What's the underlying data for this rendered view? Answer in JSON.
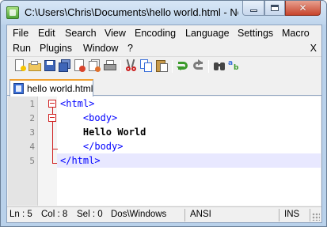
{
  "window": {
    "title": "C:\\Users\\Chris\\Documents\\hello world.html - Notepad++",
    "close_glyph": "✕"
  },
  "menu": {
    "row1": [
      "File",
      "Edit",
      "Search",
      "View",
      "Encoding",
      "Language",
      "Settings",
      "Macro"
    ],
    "row2": [
      "Run",
      "Plugins",
      "Window",
      "?"
    ],
    "close_x": "X"
  },
  "toolbar": {
    "buttons": [
      "new-file-icon",
      "open-file-icon",
      "save-icon",
      "save-all-icon",
      "close-icon",
      "close-all-icon",
      "print-icon",
      "cut-icon",
      "copy-icon",
      "paste-icon",
      "undo-icon",
      "redo-icon",
      "find-icon",
      "replace-icon"
    ]
  },
  "tabs": [
    {
      "label": "hello world.html",
      "active": true
    }
  ],
  "editor": {
    "lines": [
      {
        "num": "1",
        "segments": [
          {
            "cls": "tag",
            "text": "<html>"
          }
        ]
      },
      {
        "num": "2",
        "segments": [
          {
            "cls": "tag",
            "text": "    <body>"
          }
        ]
      },
      {
        "num": "3",
        "segments": [
          {
            "cls": "text",
            "text": "    Hello World"
          }
        ]
      },
      {
        "num": "4",
        "segments": [
          {
            "cls": "tag",
            "text": "    </body>"
          }
        ]
      },
      {
        "num": "5",
        "segments": [
          {
            "cls": "tag",
            "text": "</html>"
          }
        ]
      }
    ],
    "current_line": 5
  },
  "status": {
    "ln": "Ln : 5",
    "col": "Col : 8",
    "sel": "Sel : 0",
    "eol": "Dos\\Windows",
    "encoding": "ANSI",
    "mode": "INS"
  },
  "colors": {
    "tag": "#0000ff",
    "fold_marker": "#d02020",
    "current_line": "#e8e8ff",
    "tab_accent": "#f0a030"
  }
}
